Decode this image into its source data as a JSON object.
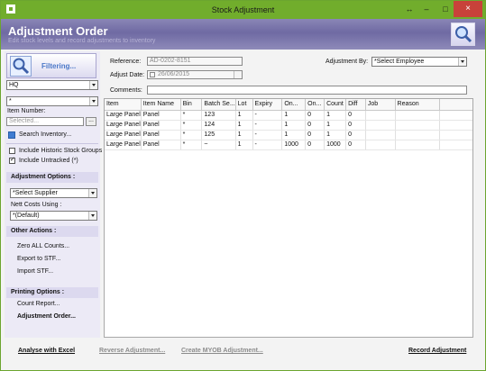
{
  "window": {
    "title": "Stock Adjustment",
    "controls": {
      "resize": "↔",
      "minimize": "–",
      "maximize": "□",
      "close": "×"
    }
  },
  "header": {
    "title": "Adjustment Order",
    "subtitle": "Edit stock levels and record adjustments to inventory"
  },
  "sidebar": {
    "filter_label": "Filtering...",
    "location_value": "HQ",
    "second_combo_value": "*",
    "item_number_label": "Item Number:",
    "item_number_placeholder": "Selected...",
    "browse_label": "...",
    "search_inventory": "Search Inventory...",
    "include_historic": {
      "label": "Include Historic Stock Groups",
      "checked": false
    },
    "include_untracked": {
      "label": "Include Untracked (*)",
      "checked": true
    },
    "adjustment_options_heading": "Adjustment Options :",
    "supplier_value": "*Select Supplier",
    "nett_costs_label": "Nett Costs Using :",
    "nett_costs_value": "*(Default)",
    "other_actions_heading": "Other Actions :",
    "other_actions": [
      "Zero ALL Counts...",
      "Export to STF...",
      "Import STF..."
    ],
    "printing_heading": "Printing Options :",
    "printing_actions": [
      "Count Report...",
      "Adjustment Order..."
    ]
  },
  "form": {
    "reference_label": "Reference:",
    "reference_value": "AD-0202-8151",
    "adjust_date_label": "Adjust Date:",
    "adjust_date_value": "26/06/2015",
    "comments_label": "Comments:",
    "comments_value": "",
    "adjustment_by_label": "Adjustment By:",
    "adjustment_by_value": "*Select Employee"
  },
  "grid": {
    "columns": [
      "Item",
      "Item Name",
      "Bin",
      "Batch Se...",
      "Lot",
      "Expiry",
      "On...",
      "On...",
      "Count",
      "Diff",
      "Job",
      "Reason"
    ],
    "rows": [
      [
        "Large Panel",
        "Panel",
        "*",
        "123",
        "1",
        "-",
        "1",
        "0",
        "1",
        "0",
        "",
        ""
      ],
      [
        "Large Panel",
        "Panel",
        "*",
        "124",
        "1",
        "-",
        "1",
        "0",
        "1",
        "0",
        "",
        ""
      ],
      [
        "Large Panel",
        "Panel",
        "*",
        "125",
        "1",
        "-",
        "1",
        "0",
        "1",
        "0",
        "",
        ""
      ],
      [
        "Large Panel",
        "Panel",
        "*",
        "~",
        "1",
        "-",
        "1000",
        "0",
        "1000",
        "0",
        "",
        ""
      ]
    ]
  },
  "footer": {
    "analyse": "Analyse with Excel",
    "reverse": "Reverse Adjustment...",
    "create_myob": "Create MYOB Adjustment...",
    "record": "Record Adjustment"
  },
  "colors": {
    "titlebar": "#71ad2c",
    "header": "#6f6aa3",
    "sidebar": "#eceaf6",
    "close": "#c8423a"
  }
}
